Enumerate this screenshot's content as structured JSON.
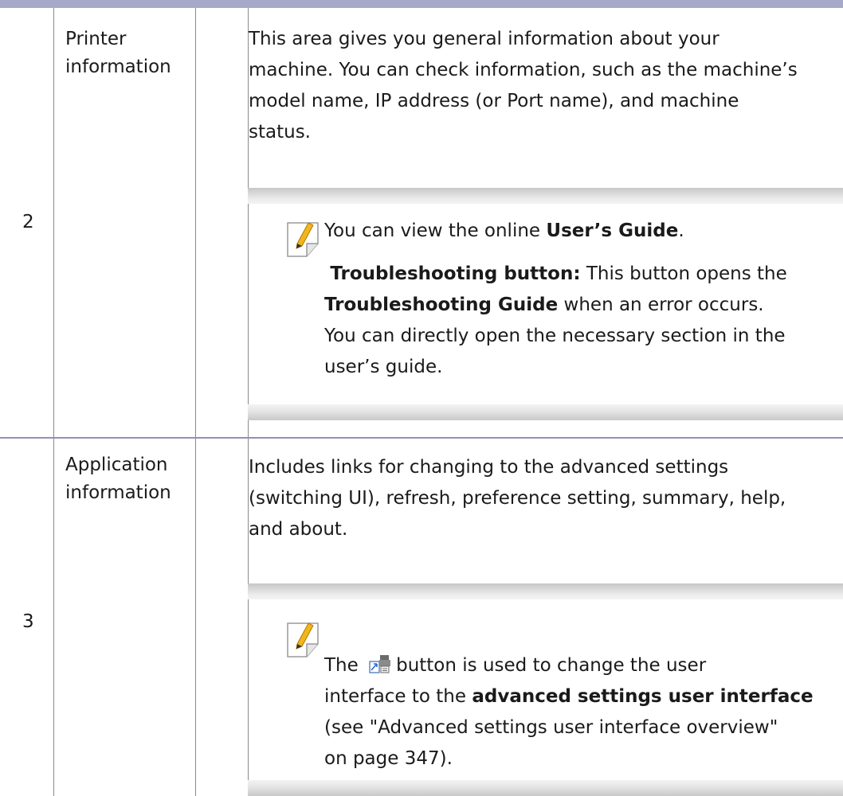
{
  "rows": [
    {
      "number": "2",
      "label": [
        "Printer",
        "information"
      ],
      "description": [
        "This area gives you general information about your",
        "machine. You can check information, such as the machine’s",
        "model name, IP address (or Port name), and machine",
        "status."
      ],
      "note": {
        "line1_a": "You can view the online ",
        "line1_b": "User’s Guide",
        "line1_c": ".",
        "line2_a": "Troubleshooting button:",
        "line2_b": " This button opens the",
        "line3_a": "Troubleshooting Guide",
        "line3_b": " when an error occurs.",
        "line4": "You can directly open the necessary section in the",
        "line5": "user’s guide."
      }
    },
    {
      "number": "3",
      "label": [
        "Application",
        "information"
      ],
      "description": [
        "Includes links for changing to the advanced settings",
        "(switching UI), refresh, preference setting, summary, help,",
        "and about."
      ],
      "note": {
        "line1_a": "The",
        "line1_b": "button is used to change the user",
        "line2_a": "interface to the ",
        "line2_b": "advanced settings user interface",
        "line3": "(see \"Advanced settings user interface overview\"",
        "line4": "on page 347)."
      }
    }
  ],
  "icons": {
    "note": "note-pencil-icon",
    "switch_ui": "switch-ui-icon"
  },
  "colors": {
    "top_bar": "#a7a9c9",
    "row_divider": "#8f92b8",
    "pencil": "#f2b51a"
  }
}
